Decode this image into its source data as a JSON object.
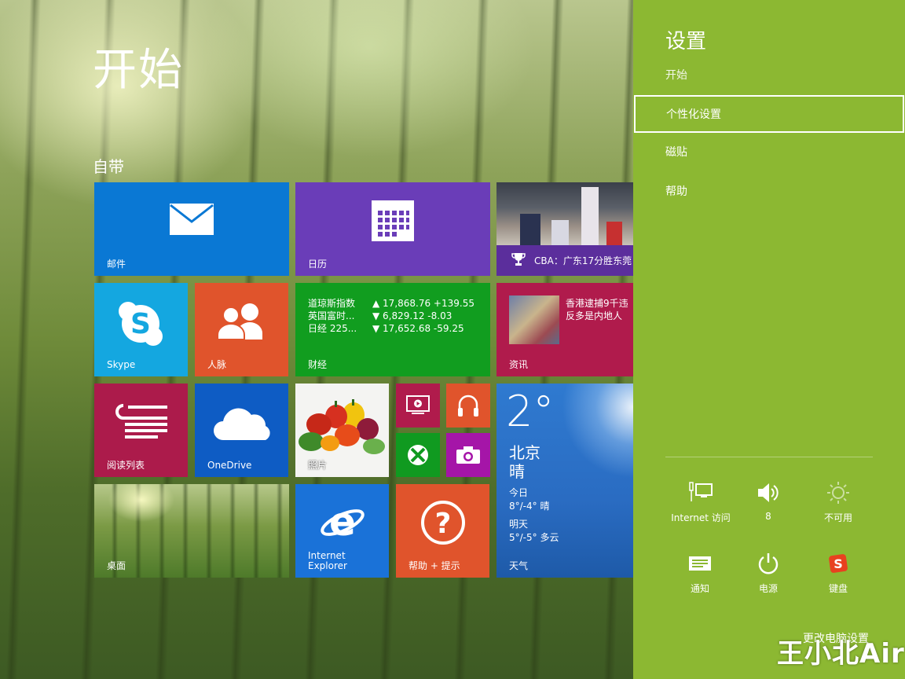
{
  "start": {
    "title": "开始",
    "group_label": "自带"
  },
  "tiles": {
    "mail": {
      "label": "邮件"
    },
    "calendar": {
      "label": "日历"
    },
    "sports": {
      "headline": "CBA：广东17分胜东莞"
    },
    "skype": {
      "label": "Skype"
    },
    "people": {
      "label": "人脉"
    },
    "finance": {
      "label": "财经",
      "rows": [
        {
          "name": "道琼斯指数",
          "value": "▲ 17,868.76 +139.55"
        },
        {
          "name": "英国富时...",
          "value": "▼ 6,829.12 -8.03"
        },
        {
          "name": "日经 225...",
          "value": "▼ 17,652.68 -59.25"
        }
      ]
    },
    "news": {
      "label": "资讯",
      "headline": "香港逮捕9千违反多是内地人"
    },
    "reading": {
      "label": "阅读列表"
    },
    "onedrive": {
      "label": "OneDrive"
    },
    "photos": {
      "label": "照片"
    },
    "desktop": {
      "label": "桌面"
    },
    "ie": {
      "label_line1": "Internet",
      "label_line2": "Explorer"
    },
    "help": {
      "label": "帮助 + 提示"
    },
    "weather": {
      "label": "天气",
      "temp": "2°",
      "city": "北京",
      "condition": "晴",
      "today_label": "今日",
      "today_value": "8°/-4° 晴",
      "tomorrow_label": "明天",
      "tomorrow_value": "5°/-5° 多云"
    }
  },
  "settings": {
    "title": "设置",
    "subtitle": "开始",
    "items": [
      {
        "label": "个性化设置"
      },
      {
        "label": "磁贴"
      },
      {
        "label": "帮助"
      }
    ],
    "quick": {
      "network": {
        "label": "Internet 访问",
        "icon": "network-icon"
      },
      "volume": {
        "label": "8",
        "icon": "speaker-icon"
      },
      "brightness": {
        "label": "不可用",
        "icon": "brightness-icon"
      },
      "notifications": {
        "label": "通知",
        "icon": "notification-icon"
      },
      "power": {
        "label": "电源",
        "icon": "power-icon"
      },
      "keyboard": {
        "label": "键盘",
        "icon": "keyboard-icon"
      }
    },
    "change_pc_settings": "更改电脑设置"
  },
  "watermark": "王小北Air",
  "colors": {
    "settings_panel": "#8cb832",
    "mail": "#0a78d4",
    "calendar": "#6a3db8",
    "finance": "#119d1f",
    "news": "#b01b4c",
    "people": "#e0542c",
    "reading": "#ac1b4b",
    "onedrive": "#0e5cc4",
    "help": "#e0542c"
  }
}
